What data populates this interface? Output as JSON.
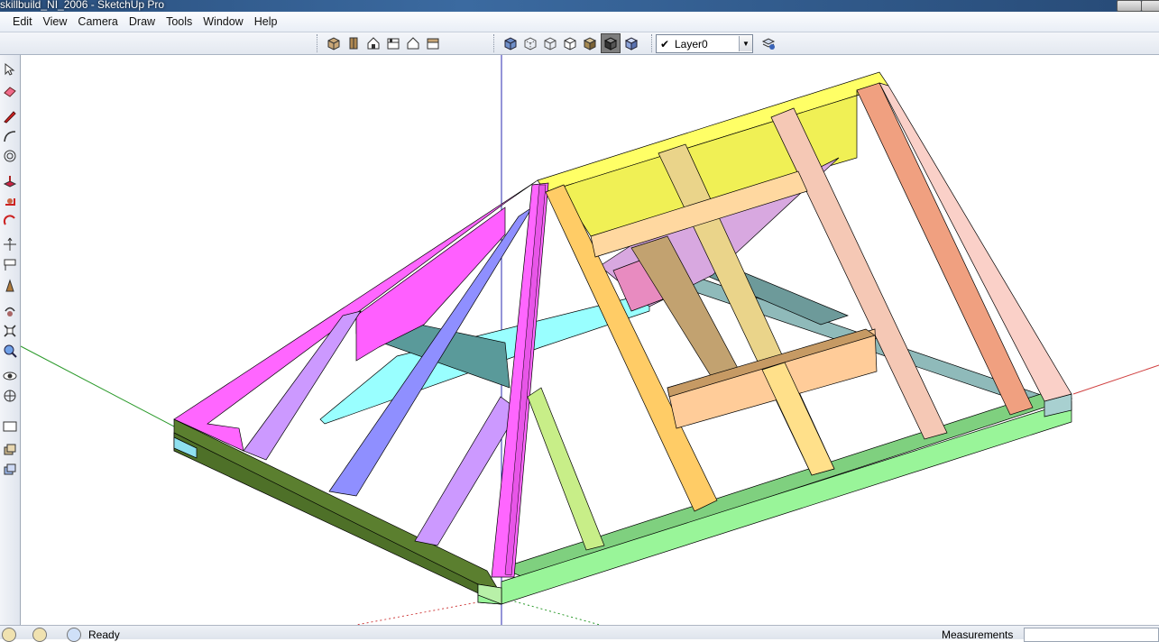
{
  "window": {
    "title": "skillbuild_NI_2006 - SketchUp Pro"
  },
  "menu": {
    "items": [
      {
        "label": "Edit"
      },
      {
        "label": "View"
      },
      {
        "label": "Camera"
      },
      {
        "label": "Draw"
      },
      {
        "label": "Tools"
      },
      {
        "label": "Window"
      },
      {
        "label": "Help"
      }
    ]
  },
  "views_toolbar": {
    "icons": [
      "iso-view-icon",
      "top-view-icon",
      "front-view-icon",
      "right-view-icon",
      "back-view-icon",
      "left-view-icon"
    ]
  },
  "style_toolbar": {
    "icons": [
      "xray-icon",
      "back-edges-icon",
      "wireframe-icon",
      "hidden-line-icon",
      "shaded-icon",
      "shaded-textures-icon",
      "monochrome-icon"
    ]
  },
  "layers": {
    "current": "Layer0",
    "checked": true
  },
  "left_tools": {
    "icons": [
      "select-icon",
      "eraser-icon",
      "pencil-icon",
      "arc-icon",
      "paint-bucket-icon",
      "push-pull-icon",
      "follow-me-icon",
      "offset-icon",
      "move-icon",
      "tape-measure-icon",
      "text-icon",
      "axes-icon",
      "orbit-icon",
      "zoom-icon",
      "zoom-extents-icon",
      "walk-icon",
      "look-around-icon",
      "section-icon",
      "section-display-icon"
    ]
  },
  "statusbar": {
    "status": "Ready",
    "measurements_label": "Measurements"
  },
  "colors": {
    "titlebar": "#2a4f7d",
    "wallplate_dark": "#5b7f2f",
    "wallplate_light": "#99f599",
    "ridge": "#ffff66",
    "hip_magenta": "#ff66ff",
    "jack_purple": "#cc99ff",
    "hip_blue": "#8f8fff",
    "rafter_orange": "#ffcc66",
    "rafter_salmon": "#f0a080",
    "tie_cyan": "#99ffff",
    "purlin_teal": "#5a9a9a"
  }
}
